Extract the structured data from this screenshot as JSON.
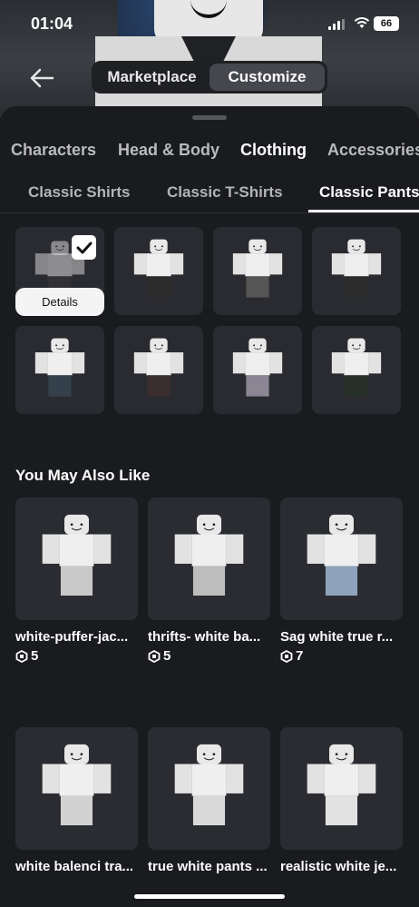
{
  "status_bar": {
    "time": "01:04",
    "battery": "66"
  },
  "header": {
    "segments": [
      "Marketplace",
      "Customize"
    ],
    "active_segment": "Customize"
  },
  "category_tabs": [
    "Characters",
    "Head & Body",
    "Clothing",
    "Accessories"
  ],
  "active_category": "Clothing",
  "subcategory_tabs": [
    "Classic Shirts",
    "Classic T-Shirts",
    "Classic Pants"
  ],
  "active_subcategory": "Classic Pants",
  "owned_items": {
    "details_label": "Details",
    "pants_colors": [
      "#3a3a3a",
      "#2b2b2b",
      "#555555",
      "#2c2c2c",
      "#34414c",
      "#3b2e31",
      "#8b8594",
      "#273028"
    ]
  },
  "recommendations": {
    "title": "You May Also Like",
    "items": [
      {
        "name": "white-puffer-jac...",
        "price": "5",
        "pants_color": "#c9c9c9"
      },
      {
        "name": "thrifts- white ba...",
        "price": "5",
        "pants_color": "#bdbdbd"
      },
      {
        "name": "Sag white true r...",
        "price": "7",
        "pants_color": "#8ea3bb"
      },
      {
        "name": "white balenci tra...",
        "price": "",
        "pants_color": "#d2d2d2"
      },
      {
        "name": "true white pants ...",
        "price": "",
        "pants_color": "#d9d9d9"
      },
      {
        "name": "realistic white je...",
        "price": "",
        "pants_color": "#e2e2e2"
      }
    ]
  },
  "colors": {
    "background": "#1a1b1f",
    "tile": "#2a2b30",
    "accent": "#ffffff"
  }
}
